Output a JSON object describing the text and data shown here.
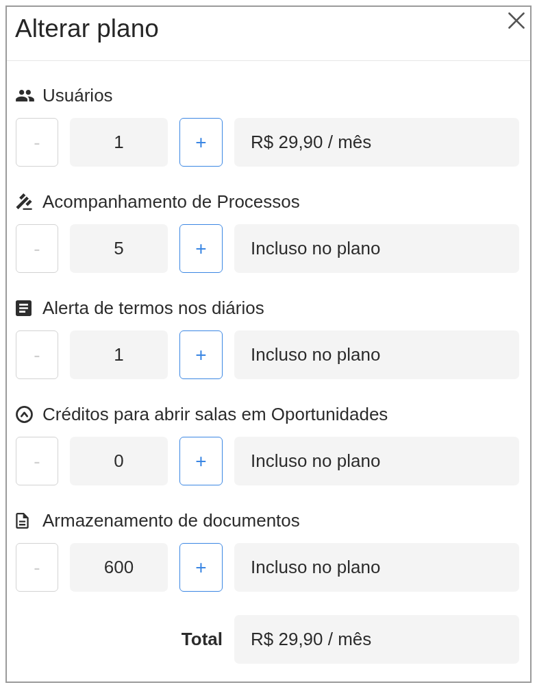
{
  "dialog": {
    "title": "Alterar plano"
  },
  "items": [
    {
      "label": "Usuários",
      "decrement": {
        "label": "-",
        "disabled": true
      },
      "quantity": "1",
      "increment": {
        "label": "+",
        "disabled": false
      },
      "price": "R$ 29,90 / mês"
    },
    {
      "label": "Acompanhamento de Processos",
      "decrement": {
        "label": "-",
        "disabled": true
      },
      "quantity": "5",
      "increment": {
        "label": "+",
        "disabled": false
      },
      "price": "Incluso no plano"
    },
    {
      "label": "Alerta de termos nos diários",
      "decrement": {
        "label": "-",
        "disabled": true
      },
      "quantity": "1",
      "increment": {
        "label": "+",
        "disabled": false
      },
      "price": "Incluso no plano"
    },
    {
      "label": "Créditos para abrir salas em Oportunidades",
      "decrement": {
        "label": "-",
        "disabled": true
      },
      "quantity": "0",
      "increment": {
        "label": "+",
        "disabled": false
      },
      "price": "Incluso no plano"
    },
    {
      "label": "Armazenamento de documentos",
      "decrement": {
        "label": "-",
        "disabled": true
      },
      "quantity": "600",
      "increment": {
        "label": "+",
        "disabled": false
      },
      "price": "Incluso no plano"
    }
  ],
  "total": {
    "label": "Total",
    "value": "R$ 29,90 / mês"
  }
}
